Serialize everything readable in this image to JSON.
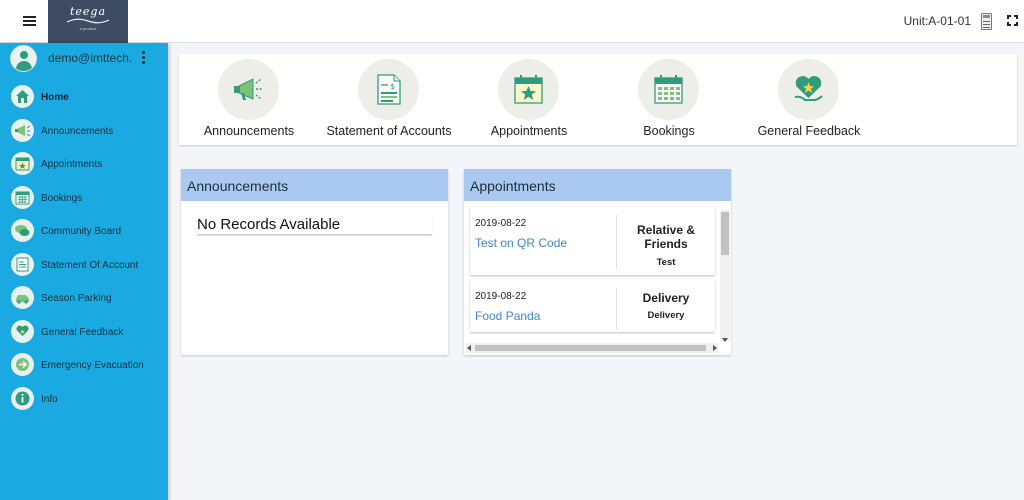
{
  "topbar": {
    "logo_text": "teega",
    "logo_sub": "a product",
    "unit_label": "Unit:A-01-01",
    "icons": [
      "menu-icon",
      "calculator-icon",
      "fullscreen-icon"
    ]
  },
  "sidebar": {
    "user_email": "demo@imttech...",
    "items": [
      {
        "label": "Home",
        "icon": "home-icon",
        "active": true
      },
      {
        "label": "Announcements",
        "icon": "megaphone-icon"
      },
      {
        "label": "Appointments",
        "icon": "calendar-star-icon"
      },
      {
        "label": "Bookings",
        "icon": "calendar-grid-icon"
      },
      {
        "label": "Community Board",
        "icon": "chat-bubbles-icon"
      },
      {
        "label": "Statement Of Account",
        "icon": "document-dollar-icon"
      },
      {
        "label": "Season Parking",
        "icon": "car-icon"
      },
      {
        "label": "General Feedback",
        "icon": "heart-hand-icon"
      },
      {
        "label": "Emergency Evacuation",
        "icon": "evacuation-icon"
      },
      {
        "label": "Info",
        "icon": "info-icon"
      }
    ]
  },
  "quick_access": [
    {
      "label": "Announcements",
      "icon": "megaphone-icon"
    },
    {
      "label": "Statement of Accounts",
      "icon": "document-dollar-icon"
    },
    {
      "label": "Appointments",
      "icon": "calendar-star-icon"
    },
    {
      "label": "Bookings",
      "icon": "calendar-grid-icon"
    },
    {
      "label": "General Feedback",
      "icon": "heart-hand-icon"
    }
  ],
  "announcements_panel": {
    "title": "Announcements",
    "empty_text": "No Records Available"
  },
  "appointments_panel": {
    "title": "Appointments",
    "items": [
      {
        "date": "2019-08-22",
        "title": "Test on QR Code",
        "type": "Relative & Friends",
        "sub": "Test"
      },
      {
        "date": "2019-08-22",
        "title": "Food Panda",
        "type": "Delivery",
        "sub": "Delivery"
      }
    ]
  },
  "colors": {
    "sidebar": "#1ba9e1",
    "panel_header": "#a9c9f1",
    "link": "#3e86cf",
    "logo_bg": "#3d4c63",
    "icon_teal": "#2f9c7e"
  }
}
